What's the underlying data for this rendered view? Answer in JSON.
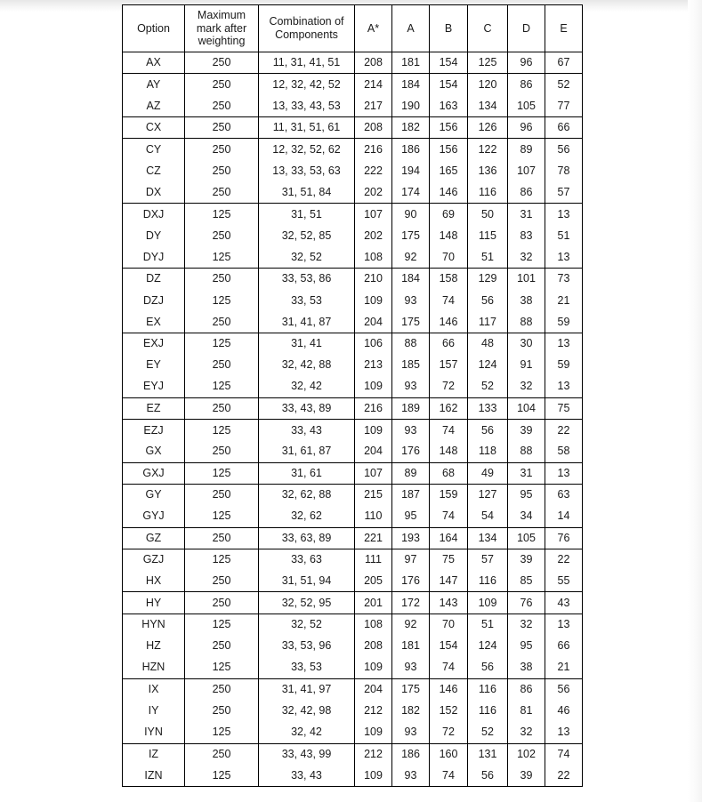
{
  "document": {
    "title": "Option grade boundaries table",
    "background_color": "#ffffff",
    "text_color": "#1a1a1a",
    "border_color": "#000000"
  },
  "table": {
    "headers": {
      "option": "Option",
      "max_mark_line1": "Maximum",
      "max_mark_line2": "mark after",
      "max_mark_line3": "weighting",
      "combination_line1": "Combination of",
      "combination_line2": "Components",
      "a_star": "A*",
      "a": "A",
      "b": "B",
      "c": "C",
      "d": "D",
      "e": "E"
    },
    "columns": [
      "Option",
      "Maximum mark after weighting",
      "Combination of Components",
      "A*",
      "A",
      "B",
      "C",
      "D",
      "E"
    ],
    "rows": [
      {
        "option": "AX",
        "max_mark": "250",
        "combination": "11, 31, 41, 51",
        "a_star": "208",
        "a": "181",
        "b": "154",
        "c": "125",
        "d": "96",
        "e": "67",
        "group_start": true
      },
      {
        "option": "AY",
        "max_mark": "250",
        "combination": "12, 32, 42, 52",
        "a_star": "214",
        "a": "184",
        "b": "154",
        "c": "120",
        "d": "86",
        "e": "52",
        "group_start": true
      },
      {
        "option": "AZ",
        "max_mark": "250",
        "combination": "13, 33, 43, 53",
        "a_star": "217",
        "a": "190",
        "b": "163",
        "c": "134",
        "d": "105",
        "e": "77",
        "group_start": false
      },
      {
        "option": "CX",
        "max_mark": "250",
        "combination": "11, 31, 51, 61",
        "a_star": "208",
        "a": "182",
        "b": "156",
        "c": "126",
        "d": "96",
        "e": "66",
        "group_start": true
      },
      {
        "option": "CY",
        "max_mark": "250",
        "combination": "12, 32, 52, 62",
        "a_star": "216",
        "a": "186",
        "b": "156",
        "c": "122",
        "d": "89",
        "e": "56",
        "group_start": true
      },
      {
        "option": "CZ",
        "max_mark": "250",
        "combination": "13, 33, 53, 63",
        "a_star": "222",
        "a": "194",
        "b": "165",
        "c": "136",
        "d": "107",
        "e": "78",
        "group_start": false
      },
      {
        "option": "DX",
        "max_mark": "250",
        "combination": "31, 51, 84",
        "a_star": "202",
        "a": "174",
        "b": "146",
        "c": "116",
        "d": "86",
        "e": "57",
        "group_start": false
      },
      {
        "option": "DXJ",
        "max_mark": "125",
        "combination": "31, 51",
        "a_star": "107",
        "a": "90",
        "b": "69",
        "c": "50",
        "d": "31",
        "e": "13",
        "group_start": true
      },
      {
        "option": "DY",
        "max_mark": "250",
        "combination": "32, 52, 85",
        "a_star": "202",
        "a": "175",
        "b": "148",
        "c": "115",
        "d": "83",
        "e": "51",
        "group_start": false
      },
      {
        "option": "DYJ",
        "max_mark": "125",
        "combination": "32, 52",
        "a_star": "108",
        "a": "92",
        "b": "70",
        "c": "51",
        "d": "32",
        "e": "13",
        "group_start": false
      },
      {
        "option": "DZ",
        "max_mark": "250",
        "combination": "33, 53, 86",
        "a_star": "210",
        "a": "184",
        "b": "158",
        "c": "129",
        "d": "101",
        "e": "73",
        "group_start": true
      },
      {
        "option": "DZJ",
        "max_mark": "125",
        "combination": "33, 53",
        "a_star": "109",
        "a": "93",
        "b": "74",
        "c": "56",
        "d": "38",
        "e": "21",
        "group_start": false
      },
      {
        "option": "EX",
        "max_mark": "250",
        "combination": "31, 41, 87",
        "a_star": "204",
        "a": "175",
        "b": "146",
        "c": "117",
        "d": "88",
        "e": "59",
        "group_start": false
      },
      {
        "option": "EXJ",
        "max_mark": "125",
        "combination": "31, 41",
        "a_star": "106",
        "a": "88",
        "b": "66",
        "c": "48",
        "d": "30",
        "e": "13",
        "group_start": true
      },
      {
        "option": "EY",
        "max_mark": "250",
        "combination": "32, 42, 88",
        "a_star": "213",
        "a": "185",
        "b": "157",
        "c": "124",
        "d": "91",
        "e": "59",
        "group_start": false
      },
      {
        "option": "EYJ",
        "max_mark": "125",
        "combination": "32, 42",
        "a_star": "109",
        "a": "93",
        "b": "72",
        "c": "52",
        "d": "32",
        "e": "13",
        "group_start": false
      },
      {
        "option": "EZ",
        "max_mark": "250",
        "combination": "33, 43, 89",
        "a_star": "216",
        "a": "189",
        "b": "162",
        "c": "133",
        "d": "104",
        "e": "75",
        "group_start": true
      },
      {
        "option": "EZJ",
        "max_mark": "125",
        "combination": "33, 43",
        "a_star": "109",
        "a": "93",
        "b": "74",
        "c": "56",
        "d": "39",
        "e": "22",
        "group_start": true
      },
      {
        "option": "GX",
        "max_mark": "250",
        "combination": "31, 61, 87",
        "a_star": "204",
        "a": "176",
        "b": "148",
        "c": "118",
        "d": "88",
        "e": "58",
        "group_start": false
      },
      {
        "option": "GXJ",
        "max_mark": "125",
        "combination": "31, 61",
        "a_star": "107",
        "a": "89",
        "b": "68",
        "c": "49",
        "d": "31",
        "e": "13",
        "group_start": true
      },
      {
        "option": "GY",
        "max_mark": "250",
        "combination": "32, 62, 88",
        "a_star": "215",
        "a": "187",
        "b": "159",
        "c": "127",
        "d": "95",
        "e": "63",
        "group_start": true
      },
      {
        "option": "GYJ",
        "max_mark": "125",
        "combination": "32, 62",
        "a_star": "110",
        "a": "95",
        "b": "74",
        "c": "54",
        "d": "34",
        "e": "14",
        "group_start": false
      },
      {
        "option": "GZ",
        "max_mark": "250",
        "combination": "33, 63, 89",
        "a_star": "221",
        "a": "193",
        "b": "164",
        "c": "134",
        "d": "105",
        "e": "76",
        "group_start": true
      },
      {
        "option": "GZJ",
        "max_mark": "125",
        "combination": "33, 63",
        "a_star": "111",
        "a": "97",
        "b": "75",
        "c": "57",
        "d": "39",
        "e": "22",
        "group_start": true
      },
      {
        "option": "HX",
        "max_mark": "250",
        "combination": "31, 51, 94",
        "a_star": "205",
        "a": "176",
        "b": "147",
        "c": "116",
        "d": "85",
        "e": "55",
        "group_start": false
      },
      {
        "option": "HY",
        "max_mark": "250",
        "combination": "32, 52, 95",
        "a_star": "201",
        "a": "172",
        "b": "143",
        "c": "109",
        "d": "76",
        "e": "43",
        "group_start": true
      },
      {
        "option": "HYN",
        "max_mark": "125",
        "combination": "32, 52",
        "a_star": "108",
        "a": "92",
        "b": "70",
        "c": "51",
        "d": "32",
        "e": "13",
        "group_start": true
      },
      {
        "option": "HZ",
        "max_mark": "250",
        "combination": "33, 53, 96",
        "a_star": "208",
        "a": "181",
        "b": "154",
        "c": "124",
        "d": "95",
        "e": "66",
        "group_start": false
      },
      {
        "option": "HZN",
        "max_mark": "125",
        "combination": "33, 53",
        "a_star": "109",
        "a": "93",
        "b": "74",
        "c": "56",
        "d": "38",
        "e": "21",
        "group_start": false
      },
      {
        "option": "IX",
        "max_mark": "250",
        "combination": "31, 41, 97",
        "a_star": "204",
        "a": "175",
        "b": "146",
        "c": "116",
        "d": "86",
        "e": "56",
        "group_start": true
      },
      {
        "option": "IY",
        "max_mark": "250",
        "combination": "32, 42, 98",
        "a_star": "212",
        "a": "182",
        "b": "152",
        "c": "116",
        "d": "81",
        "e": "46",
        "group_start": false
      },
      {
        "option": "IYN",
        "max_mark": "125",
        "combination": "32, 42",
        "a_star": "109",
        "a": "93",
        "b": "72",
        "c": "52",
        "d": "32",
        "e": "13",
        "group_start": false
      },
      {
        "option": "IZ",
        "max_mark": "250",
        "combination": "33, 43, 99",
        "a_star": "212",
        "a": "186",
        "b": "160",
        "c": "131",
        "d": "102",
        "e": "74",
        "group_start": true
      },
      {
        "option": "IZN",
        "max_mark": "125",
        "combination": "33, 43",
        "a_star": "109",
        "a": "93",
        "b": "74",
        "c": "56",
        "d": "39",
        "e": "22",
        "group_start": false
      }
    ]
  }
}
